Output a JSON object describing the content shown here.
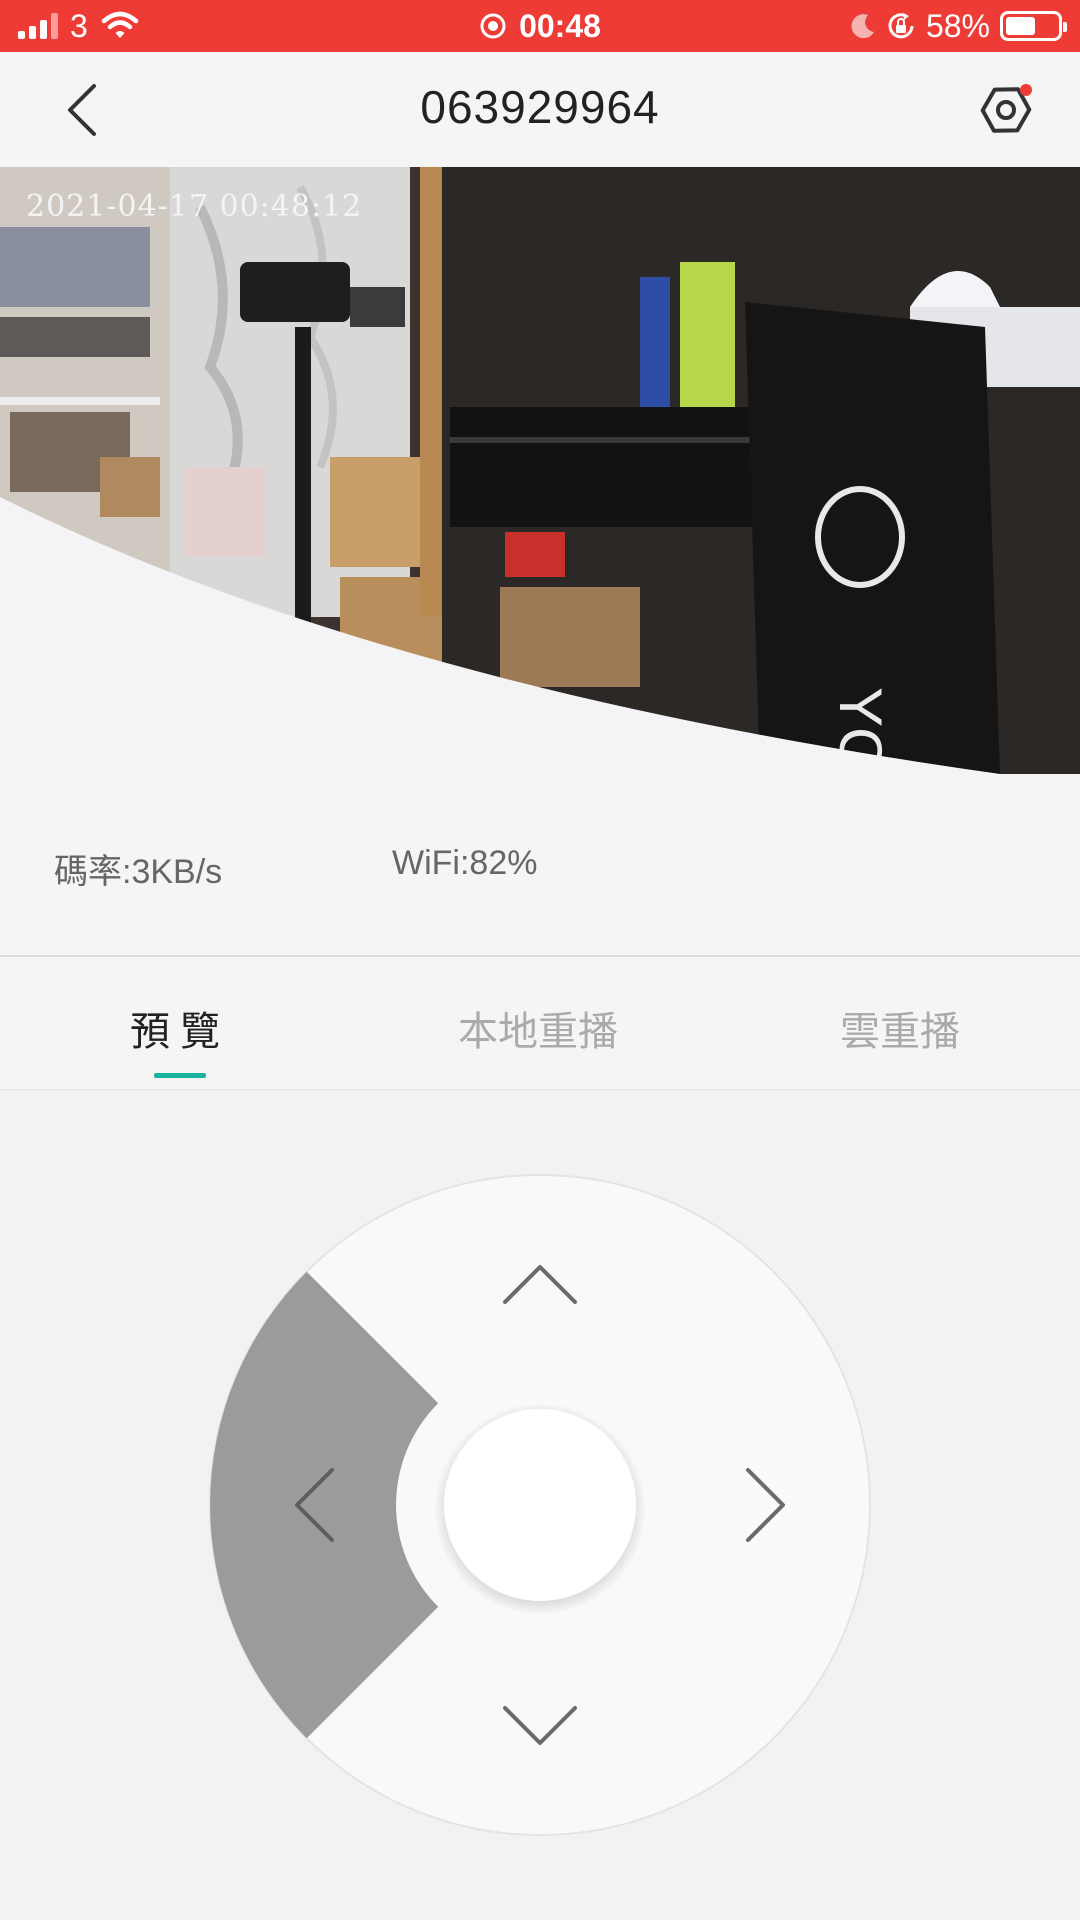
{
  "status_bar": {
    "carrier": "3",
    "time": "00:48",
    "battery": "58%",
    "battery_level": 0.58,
    "icons": [
      "signal-icon",
      "wifi-icon",
      "record-icon",
      "moon-icon",
      "rotation-lock-icon",
      "battery-icon"
    ]
  },
  "nav": {
    "title": "063929964",
    "back_icon": "chevron-left-icon",
    "settings_icon": "hexagon-settings-icon"
  },
  "video": {
    "timestamp": "2021-04-17 00:48:12"
  },
  "stats": {
    "bitrate": "碼率:3KB/s",
    "wifi": "WiFi:82%"
  },
  "tabs": [
    {
      "label": "預覽",
      "active": true
    },
    {
      "label": "本地重播",
      "active": false
    },
    {
      "label": "雲重播",
      "active": false
    }
  ],
  "ptz": {
    "active_direction": "left",
    "buttons": [
      "up",
      "down",
      "left",
      "right",
      "center"
    ]
  },
  "colors": {
    "status_red": "#ef3b36",
    "tab_accent": "#17b39d",
    "pad_active": "#9b9b9b"
  }
}
